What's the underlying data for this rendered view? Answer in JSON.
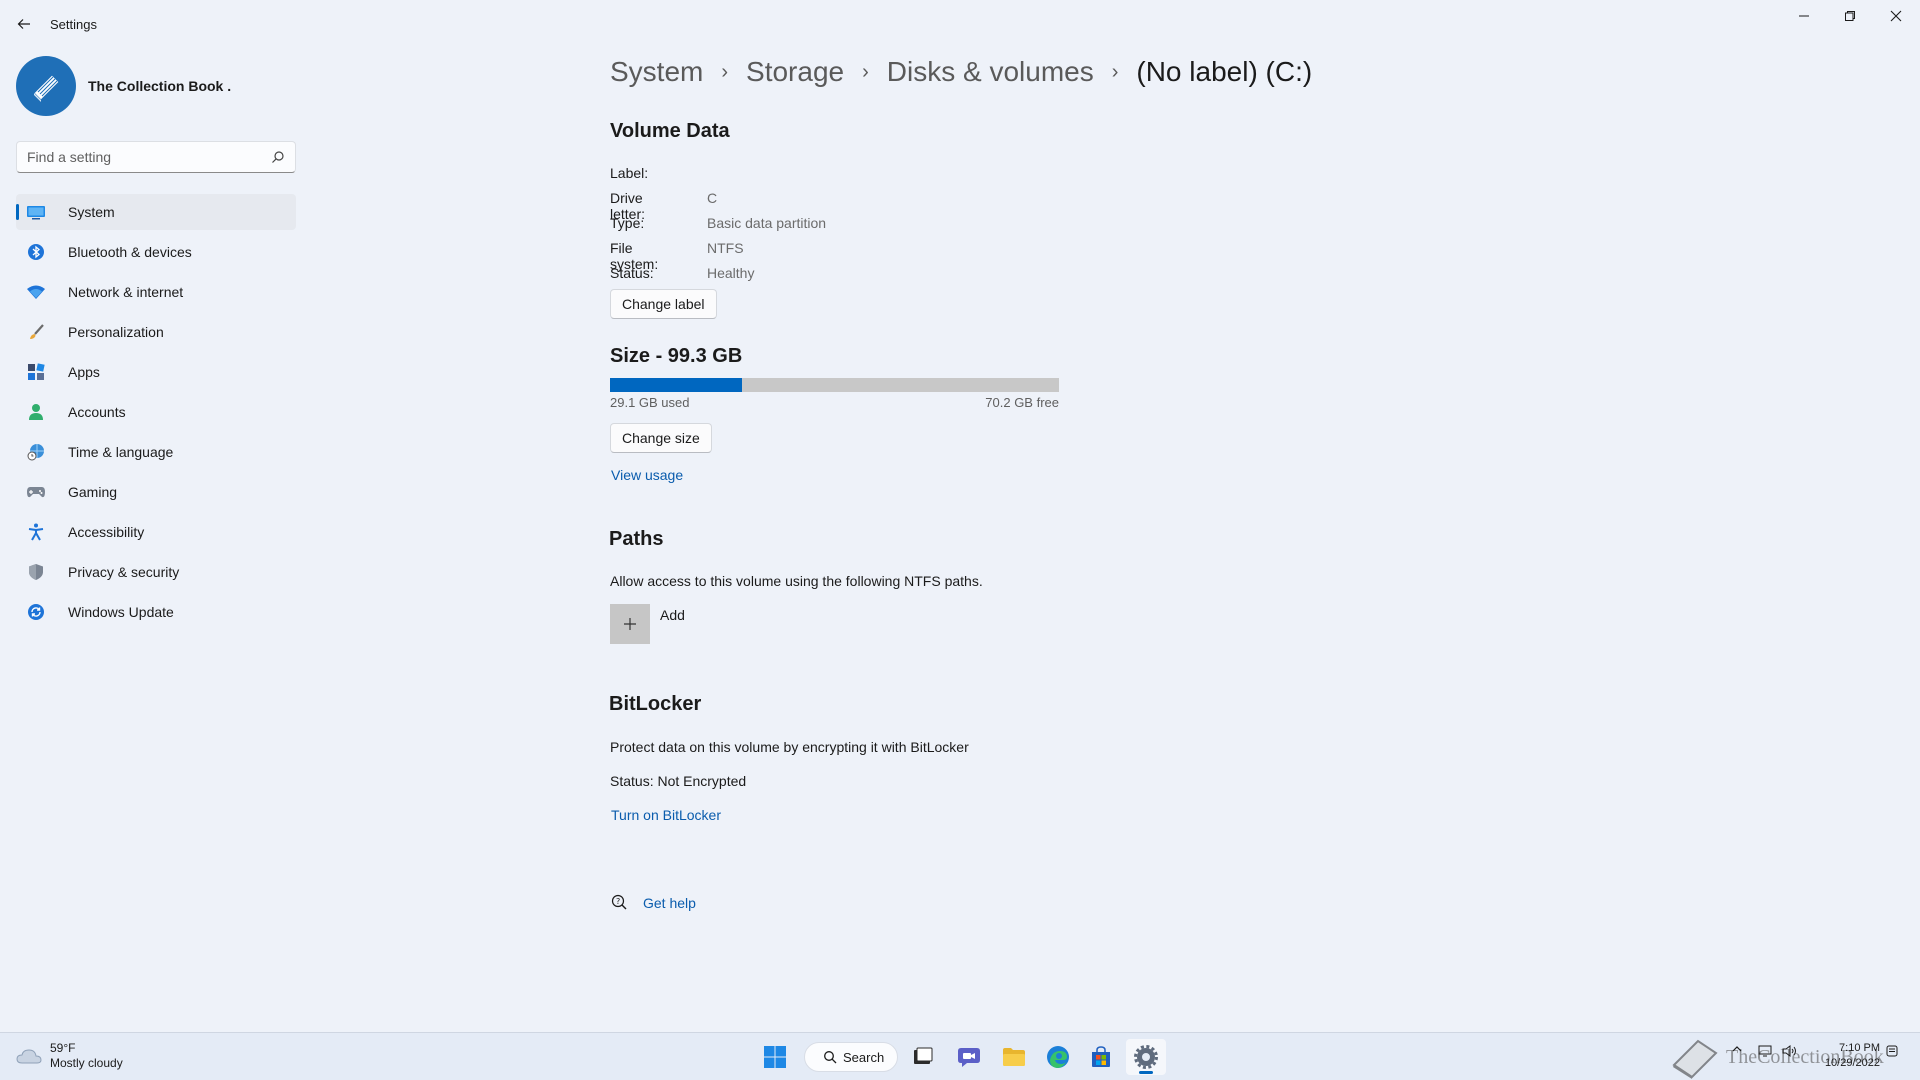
{
  "window": {
    "title": "Settings"
  },
  "profile": {
    "name": "The Collection Book ."
  },
  "search": {
    "placeholder": "Find a setting"
  },
  "sidebar": {
    "items": [
      {
        "label": "System",
        "icon": "system-icon"
      },
      {
        "label": "Bluetooth & devices",
        "icon": "bluetooth-icon"
      },
      {
        "label": "Network & internet",
        "icon": "wifi-icon"
      },
      {
        "label": "Personalization",
        "icon": "brush-icon"
      },
      {
        "label": "Apps",
        "icon": "apps-icon"
      },
      {
        "label": "Accounts",
        "icon": "account-icon"
      },
      {
        "label": "Time & language",
        "icon": "globe-clock-icon"
      },
      {
        "label": "Gaming",
        "icon": "gamepad-icon"
      },
      {
        "label": "Accessibility",
        "icon": "accessibility-icon"
      },
      {
        "label": "Privacy & security",
        "icon": "shield-icon"
      },
      {
        "label": "Windows Update",
        "icon": "update-icon"
      }
    ]
  },
  "breadcrumb": {
    "items": [
      "System",
      "Storage",
      "Disks & volumes"
    ],
    "current": "(No label) (C:)"
  },
  "volume": {
    "title": "Volume Data",
    "fields": [
      {
        "key": "Label:",
        "value": ""
      },
      {
        "key": "Drive letter:",
        "value": "C"
      },
      {
        "key": "Type:",
        "value": "Basic data partition"
      },
      {
        "key": "File system:",
        "value": "NTFS"
      },
      {
        "key": "Status:",
        "value": "Healthy"
      }
    ],
    "change_label_button": "Change label"
  },
  "size": {
    "title": "Size - 99.3 GB",
    "used_label": "29.1 GB used",
    "free_label": "70.2 GB free",
    "used_fraction": 0.293,
    "change_size_button": "Change size",
    "view_usage_link": "View usage"
  },
  "paths": {
    "title": "Paths",
    "description": "Allow access to this volume using the following NTFS paths.",
    "add_label": "Add"
  },
  "bitlocker": {
    "title": "BitLocker",
    "description": "Protect data on this volume by encrypting it with BitLocker",
    "status": "Status: Not Encrypted",
    "turn_on_link": "Turn on BitLocker"
  },
  "help": {
    "label": "Get help"
  },
  "taskbar": {
    "weather_temp": "59°F",
    "weather_desc": "Mostly cloudy",
    "search_label": "Search",
    "time": "7:10 PM",
    "date": "10/29/2022",
    "watermark": "TheCollectionBook"
  },
  "colors": {
    "accent": "#0067c0",
    "link": "#0a5cad",
    "background": "#eef2f9"
  }
}
